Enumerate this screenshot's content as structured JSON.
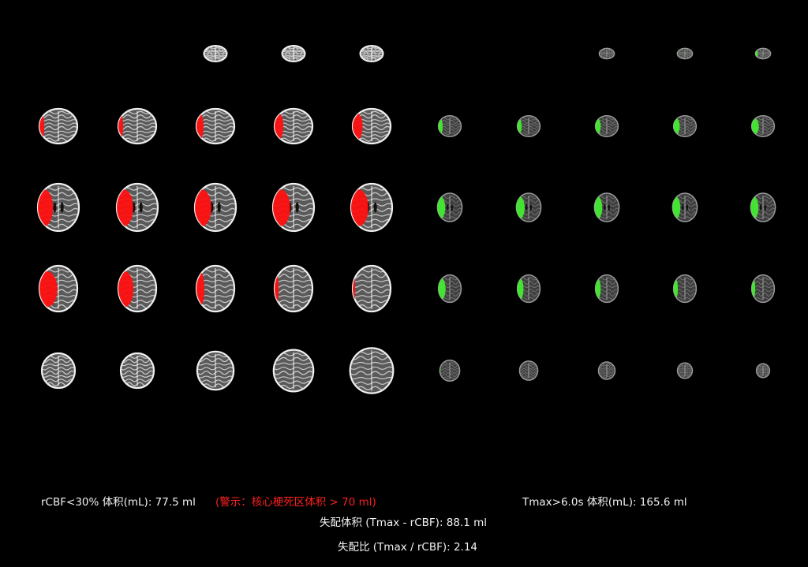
{
  "colors": {
    "background": "#000000",
    "core_overlay": "#ff1010",
    "tmax_overlay": "#43f02f",
    "warning_text": "#ff1f1f",
    "stat_text": "#f2f2f2"
  },
  "core_panel": {
    "overlay": "rCBF<30%",
    "slices": [
      [
        null,
        null,
        {
          "scan": 0.9,
          "overlay": 0
        },
        {
          "scan": 0.9,
          "overlay": 0
        },
        {
          "scan": 0.9,
          "overlay": 0
        }
      ],
      [
        {
          "scan": 1.0,
          "overlay": 0.12
        },
        {
          "scan": 1.0,
          "overlay": 0.12
        },
        {
          "scan": 1.0,
          "overlay": 0.18
        },
        {
          "scan": 1.0,
          "overlay": 0.22
        },
        {
          "scan": 1.0,
          "overlay": 0.25
        }
      ],
      [
        {
          "scan": 1.0,
          "overlay": 0.35
        },
        {
          "scan": 1.0,
          "overlay": 0.38
        },
        {
          "scan": 1.0,
          "overlay": 0.38
        },
        {
          "scan": 1.0,
          "overlay": 0.4
        },
        {
          "scan": 1.0,
          "overlay": 0.4
        }
      ],
      [
        {
          "scan": 1.0,
          "overlay": 0.45
        },
        {
          "scan": 1.0,
          "overlay": 0.38
        },
        {
          "scan": 1.0,
          "overlay": 0.2
        },
        {
          "scan": 1.0,
          "overlay": 0.1
        },
        {
          "scan": 1.0,
          "overlay": 0.06
        }
      ],
      [
        {
          "scan": 1.0,
          "overlay": 0
        },
        {
          "scan": 1.0,
          "overlay": 0
        },
        {
          "scan": 1.1,
          "overlay": 0
        },
        {
          "scan": 1.2,
          "overlay": 0
        },
        {
          "scan": 1.3,
          "overlay": 0
        }
      ]
    ]
  },
  "perfusion_panel": {
    "overlay": "Tmax>6.0s",
    "slices": [
      [
        null,
        null,
        {
          "scan": 0.6,
          "overlay": 0
        },
        {
          "scan": 0.6,
          "overlay": 0.03
        },
        {
          "scan": 0.6,
          "overlay": 0.15
        }
      ],
      [
        {
          "scan": 0.6,
          "overlay": 0.18
        },
        {
          "scan": 0.6,
          "overlay": 0.18
        },
        {
          "scan": 0.6,
          "overlay": 0.22
        },
        {
          "scan": 0.6,
          "overlay": 0.26
        },
        {
          "scan": 0.6,
          "overlay": 0.3
        }
      ],
      [
        {
          "scan": 0.6,
          "overlay": 0.3
        },
        {
          "scan": 0.6,
          "overlay": 0.32
        },
        {
          "scan": 0.6,
          "overlay": 0.3
        },
        {
          "scan": 0.6,
          "overlay": 0.3
        },
        {
          "scan": 0.6,
          "overlay": 0.3
        }
      ],
      [
        {
          "scan": 0.6,
          "overlay": 0.3
        },
        {
          "scan": 0.6,
          "overlay": 0.26
        },
        {
          "scan": 0.6,
          "overlay": 0.22
        },
        {
          "scan": 0.6,
          "overlay": 0.18
        },
        {
          "scan": 0.6,
          "overlay": 0.15
        }
      ],
      [
        {
          "scan": 0.6,
          "overlay": 0.03
        },
        {
          "scan": 0.55,
          "overlay": 0
        },
        {
          "scan": 0.5,
          "overlay": 0
        },
        {
          "scan": 0.45,
          "overlay": 0
        },
        {
          "scan": 0.4,
          "overlay": 0
        }
      ]
    ]
  },
  "stats": {
    "core_volume": "rCBF<30% 体积(mL): 77.5 ml",
    "core_warning": "(警示：核心梗死区体积 > 70 ml)",
    "tmax_volume": "Tmax>6.0s 体积(mL): 165.6 ml",
    "mismatch_volume": "失配体积 (Tmax - rCBF): 88.1 ml",
    "mismatch_ratio": "失配比 (Tmax / rCBF): 2.14"
  }
}
